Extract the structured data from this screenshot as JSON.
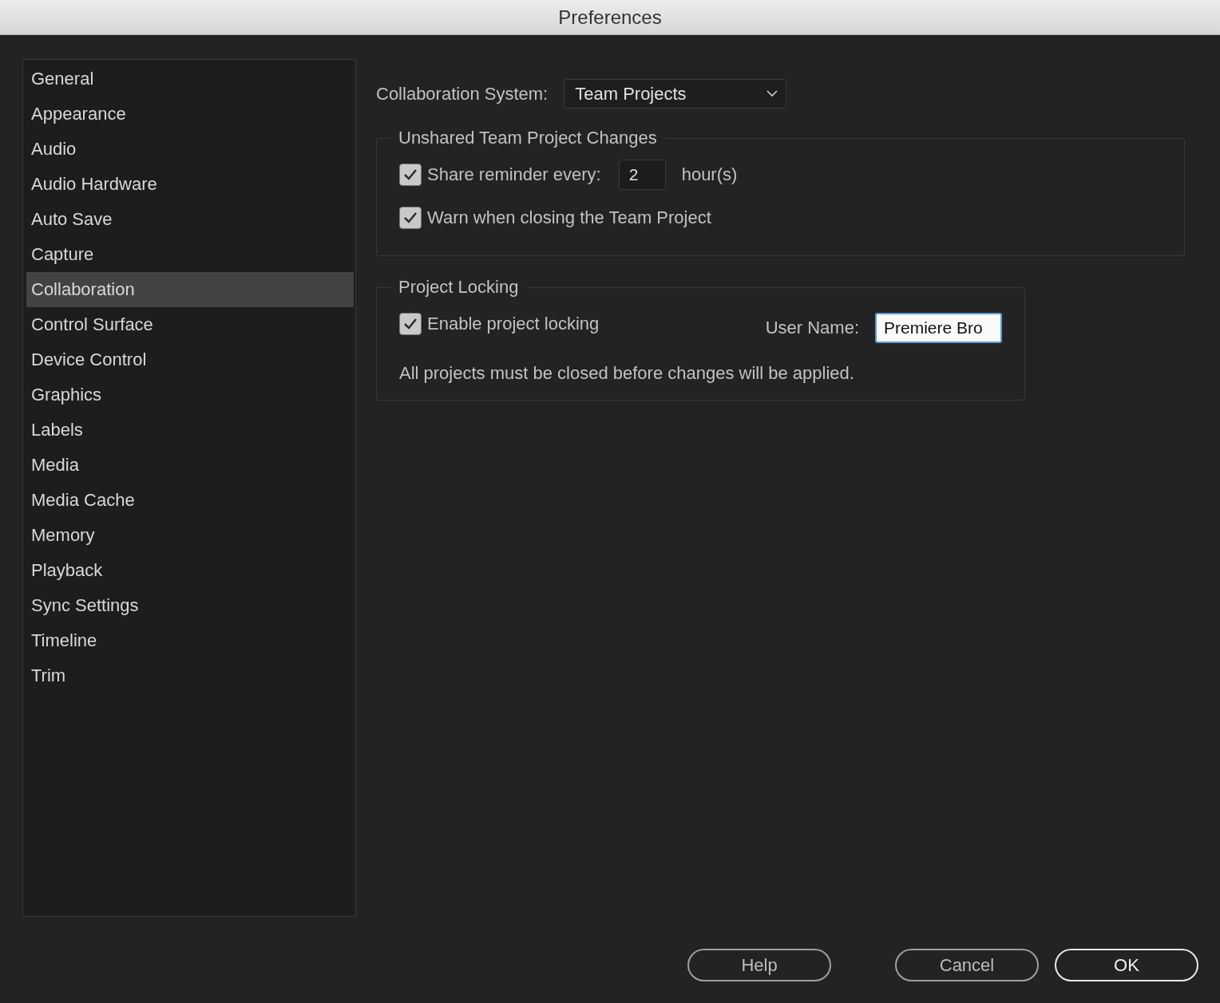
{
  "window": {
    "title": "Preferences"
  },
  "sidebar": {
    "items": [
      {
        "label": "General",
        "selected": false
      },
      {
        "label": "Appearance",
        "selected": false
      },
      {
        "label": "Audio",
        "selected": false
      },
      {
        "label": "Audio Hardware",
        "selected": false
      },
      {
        "label": "Auto Save",
        "selected": false
      },
      {
        "label": "Capture",
        "selected": false
      },
      {
        "label": "Collaboration",
        "selected": true
      },
      {
        "label": "Control Surface",
        "selected": false
      },
      {
        "label": "Device Control",
        "selected": false
      },
      {
        "label": "Graphics",
        "selected": false
      },
      {
        "label": "Labels",
        "selected": false
      },
      {
        "label": "Media",
        "selected": false
      },
      {
        "label": "Media Cache",
        "selected": false
      },
      {
        "label": "Memory",
        "selected": false
      },
      {
        "label": "Playback",
        "selected": false
      },
      {
        "label": "Sync Settings",
        "selected": false
      },
      {
        "label": "Timeline",
        "selected": false
      },
      {
        "label": "Trim",
        "selected": false
      }
    ]
  },
  "collaboration_system": {
    "label": "Collaboration System:",
    "value": "Team Projects"
  },
  "unshared_changes": {
    "title": "Unshared Team Project Changes",
    "share_reminder": {
      "label": "Share reminder every:",
      "checked": true,
      "value": "2",
      "unit": "hour(s)"
    },
    "warn_on_close": {
      "label": "Warn when closing the Team Project",
      "checked": true
    }
  },
  "project_locking": {
    "title": "Project Locking",
    "enable": {
      "label": "Enable project locking",
      "checked": true
    },
    "user_name": {
      "label": "User Name:",
      "value": "Premiere Bro",
      "focused": true
    },
    "note": "All projects must be closed before changes will be applied."
  },
  "buttons": [
    {
      "label": "Help",
      "default": false
    },
    {
      "label": "Cancel",
      "default": false
    },
    {
      "label": "OK",
      "default": true
    }
  ]
}
